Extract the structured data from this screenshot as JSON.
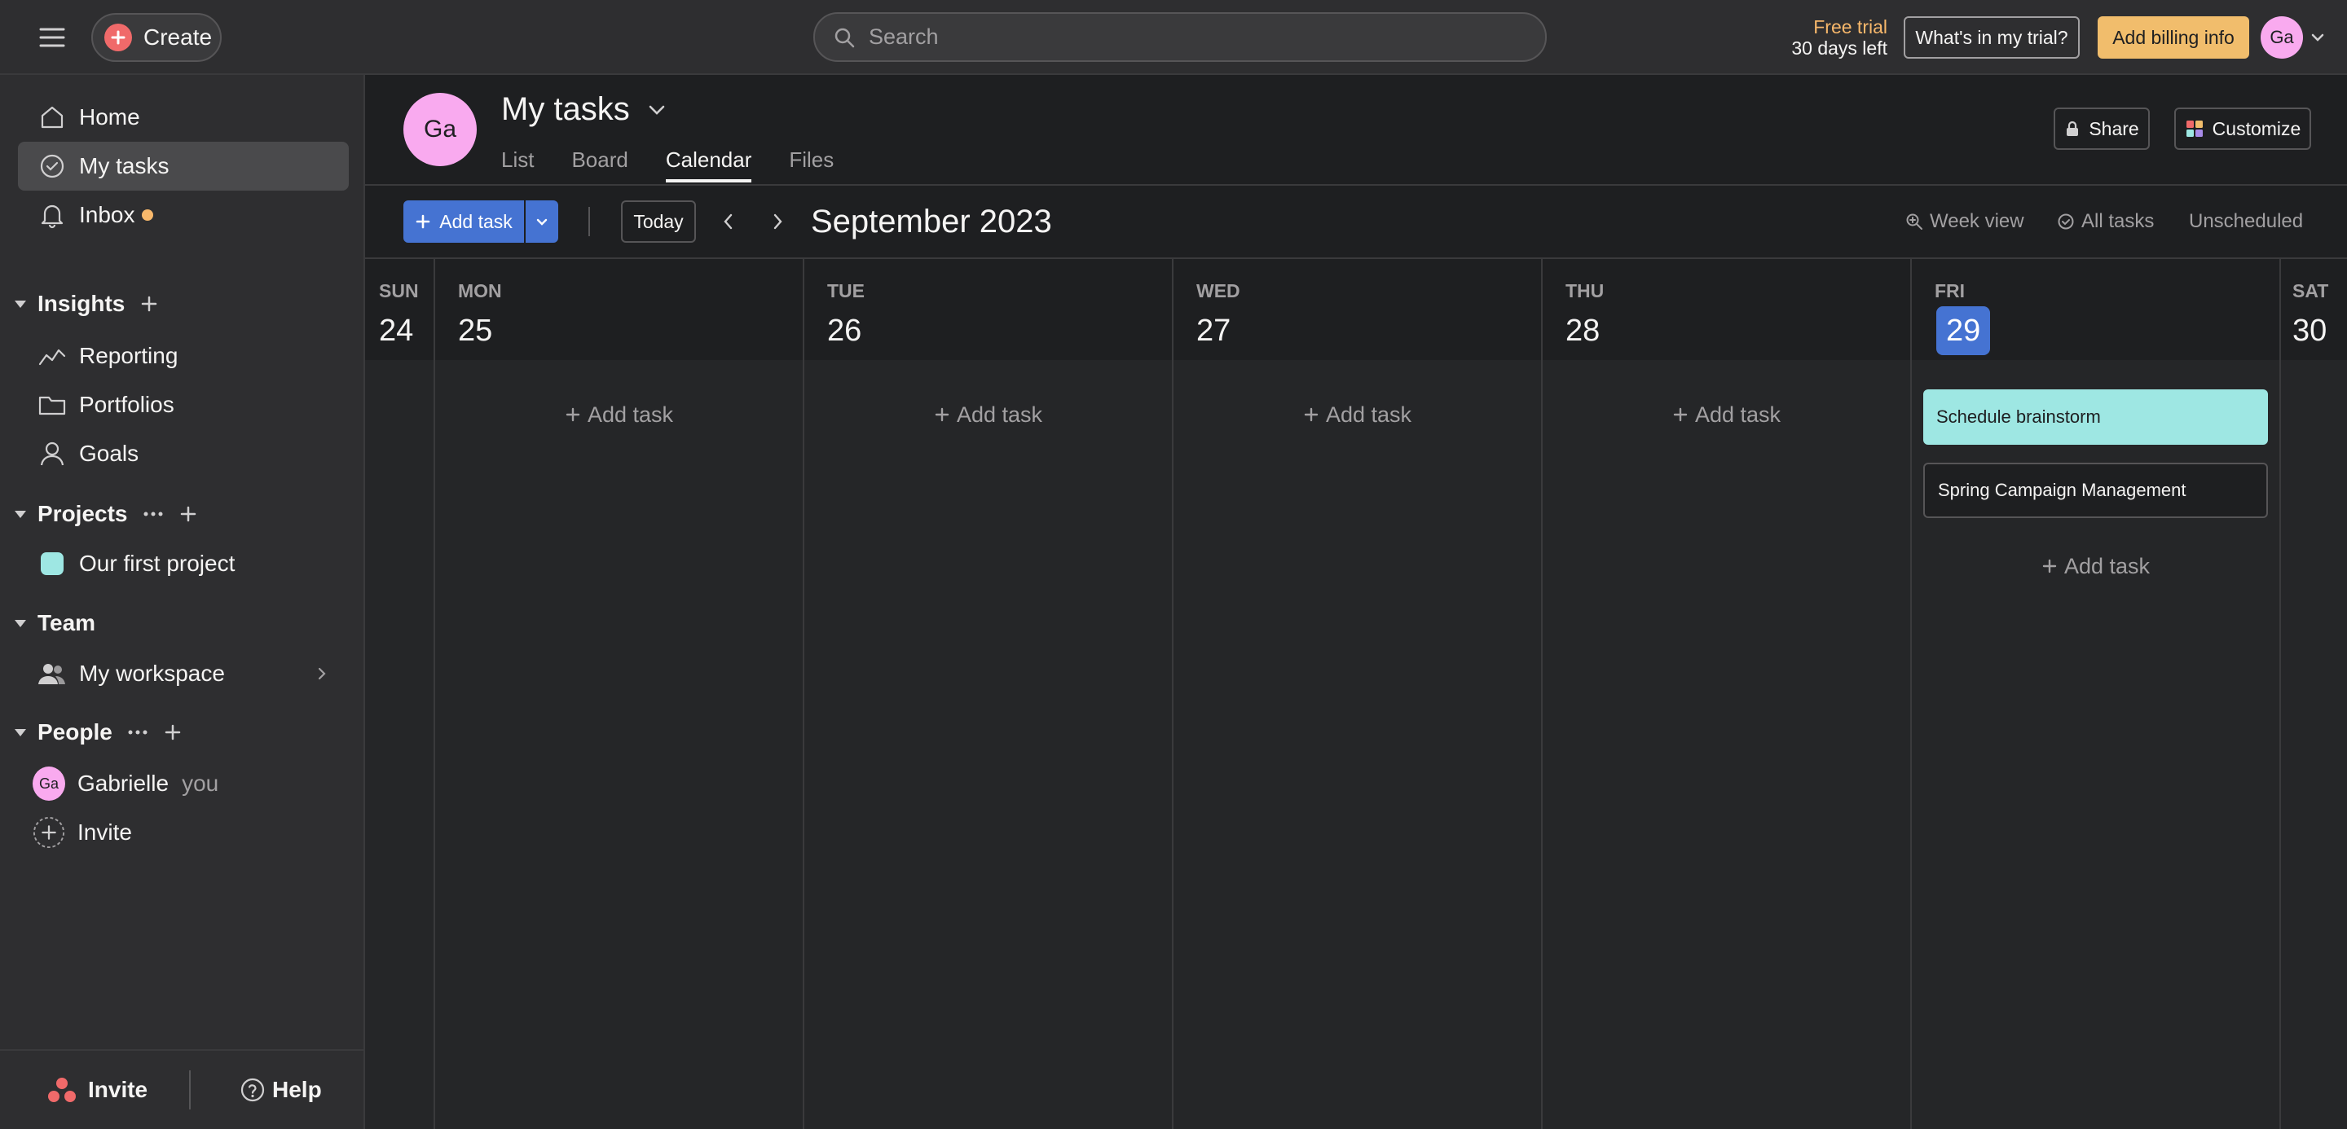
{
  "topbar": {
    "create_label": "Create",
    "search_placeholder": "Search",
    "trial_line1": "Free trial",
    "trial_line2": "30 days left",
    "whats_in_trial": "What's in my trial?",
    "add_billing": "Add billing info",
    "avatar_initials": "Ga"
  },
  "sidebar": {
    "nav": [
      {
        "label": "Home",
        "icon": "home-icon"
      },
      {
        "label": "My tasks",
        "icon": "check-circle-icon",
        "active": true
      },
      {
        "label": "Inbox",
        "icon": "bell-icon",
        "badge": true
      }
    ],
    "insights": {
      "title": "Insights",
      "items": [
        {
          "label": "Reporting",
          "icon": "line-chart-icon"
        },
        {
          "label": "Portfolios",
          "icon": "folder-icon"
        },
        {
          "label": "Goals",
          "icon": "person-icon"
        }
      ]
    },
    "projects": {
      "title": "Projects",
      "items": [
        {
          "label": "Our first project",
          "color": "#9ee7e3"
        }
      ]
    },
    "team": {
      "title": "Team",
      "items": [
        {
          "label": "My workspace",
          "icon": "people-icon"
        }
      ]
    },
    "people": {
      "title": "People",
      "items": [
        {
          "label": "Gabrielle",
          "initials": "Ga",
          "suffix": "you"
        }
      ],
      "invite_label": "Invite"
    },
    "footer": {
      "invite_label": "Invite",
      "help_label": "Help"
    }
  },
  "header": {
    "avatar_initials": "Ga",
    "title": "My tasks",
    "tabs": [
      {
        "label": "List"
      },
      {
        "label": "Board"
      },
      {
        "label": "Calendar",
        "active": true
      },
      {
        "label": "Files"
      }
    ],
    "share_label": "Share",
    "customize_label": "Customize"
  },
  "toolbar": {
    "add_task_label": "Add task",
    "today_label": "Today",
    "month_label": "September 2023",
    "week_view_label": "Week view",
    "all_tasks_label": "All tasks",
    "unscheduled_label": "Unscheduled"
  },
  "calendar": {
    "add_task_label": "Add task",
    "days": [
      {
        "name": "SUN",
        "num": "24"
      },
      {
        "name": "MON",
        "num": "25"
      },
      {
        "name": "TUE",
        "num": "26"
      },
      {
        "name": "WED",
        "num": "27"
      },
      {
        "name": "THU",
        "num": "28"
      },
      {
        "name": "FRI",
        "num": "29",
        "today": true
      },
      {
        "name": "SAT",
        "num": "30"
      }
    ],
    "fri_tasks": [
      {
        "title": "Schedule brainstorm",
        "style": "teal"
      },
      {
        "title": "Spring Campaign Management",
        "style": "dark"
      }
    ]
  },
  "colors": {
    "accent_blue": "#4573d2",
    "create_red": "#f06a6a",
    "billing_orange": "#f1bd6c",
    "avatar_pink": "#f9aaef",
    "teal_task": "#9ee7e3"
  }
}
